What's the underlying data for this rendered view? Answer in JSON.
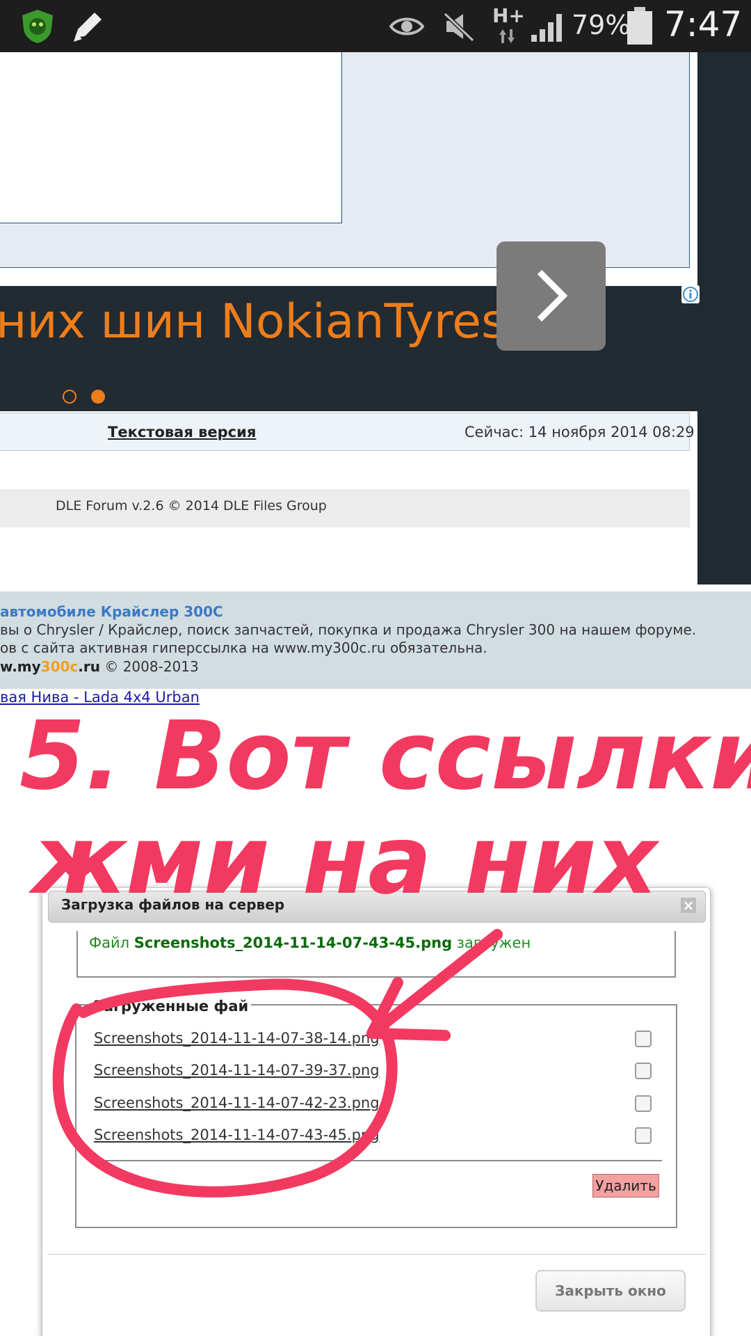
{
  "status_bar": {
    "battery_percent": "79%",
    "time": "7:47",
    "network_label": "H+",
    "icons": [
      "antivirus-shield-icon",
      "pencil-icon",
      "eye-icon",
      "mute-icon",
      "signal-icon",
      "battery-icon"
    ]
  },
  "ad": {
    "text": "них шин NokianTyres",
    "next_icon": "chevron-right-icon",
    "info_icon": "info-icon"
  },
  "forum_footer": {
    "text_version_link": "Текстовая версия",
    "now_label": "Сейчас: 14 ноября 2014 08:29",
    "copyright": "DLE Forum v.2.6 © 2014 DLE Files Group"
  },
  "site_footer": {
    "title": "автомобиле Крайслер 300С",
    "line1": "вы о Chrysler / Крайслер, поиск запчастей, покупка и продажа Chrysler 300 на нашем форуме.",
    "line2": "ов с сайта активная гиперссылка на www.my300c.ru обязательна.",
    "domain_prefix": "w.my",
    "domain_highlight": "300c",
    "domain_suffix": ".ru",
    "years": "© 2008-2013",
    "niva_link": "вая Нива - Lada 4x4 Urban"
  },
  "annotation": {
    "line1": "5. Вот ссылки",
    "line2": "жми на них"
  },
  "dialog": {
    "title": "Загрузка файлов на сервер",
    "close_icon": "close-icon",
    "message_prefix": "Файл ",
    "message_file": "Screenshots_2014-11-14-07-43-45.png",
    "message_suffix": " загружен",
    "files_legend": "Загруженные фай",
    "files": [
      "Screenshots_2014-11-14-07-38-14.png",
      "Screenshots_2014-11-14-07-39-37.png",
      "Screenshots_2014-11-14-07-42-23.png",
      "Screenshots_2014-11-14-07-43-45.png"
    ],
    "delete_label": "Удалить",
    "close_window_label": "Закрыть окно"
  },
  "colors": {
    "ad_text": "#ee7d1a",
    "annotation_red": "#f23a60",
    "upload_success": "#1e8c1e",
    "delete_button": "#f2a0a0"
  }
}
